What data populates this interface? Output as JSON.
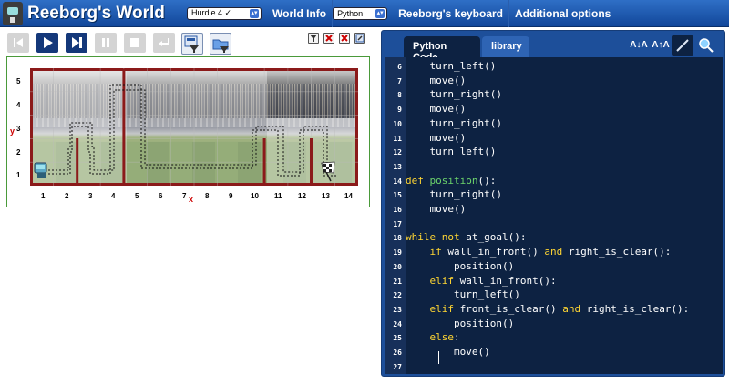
{
  "app": {
    "title": "Reeborg's World"
  },
  "topbar": {
    "world_select": "Hurdle 4 ✓",
    "world_info": "World Info",
    "language_select": "Python",
    "keyboard": "Reeborg's keyboard",
    "options": "Additional options"
  },
  "world": {
    "x_numbers": [
      "1",
      "2",
      "3",
      "4",
      "5",
      "6",
      "7",
      "8",
      "9",
      "10",
      "11",
      "12",
      "13",
      "14"
    ],
    "y_numbers": [
      "1",
      "2",
      "3",
      "4",
      "5"
    ],
    "x_label": "x",
    "y_label": "y"
  },
  "editor": {
    "tab_code": "Python Code",
    "tab_library": "library",
    "tool_decrease": "A↓A",
    "tool_increase": "A↑A",
    "lines": [
      {
        "n": "6",
        "t": "    turn_left()"
      },
      {
        "n": "7",
        "t": "    move()"
      },
      {
        "n": "8",
        "t": "    turn_right()"
      },
      {
        "n": "9",
        "t": "    move()"
      },
      {
        "n": "10",
        "t": "    turn_right()"
      },
      {
        "n": "11",
        "t": "    move()"
      },
      {
        "n": "12",
        "t": "    turn_left()"
      },
      {
        "n": "13",
        "t": ""
      },
      {
        "n": "14",
        "t": "def position():"
      },
      {
        "n": "15",
        "t": "    turn_right()"
      },
      {
        "n": "16",
        "t": "    move()"
      },
      {
        "n": "17",
        "t": ""
      },
      {
        "n": "18",
        "t": "while not at_goal():"
      },
      {
        "n": "19",
        "t": "    if wall_in_front() and right_is_clear():"
      },
      {
        "n": "20",
        "t": "        position()"
      },
      {
        "n": "21",
        "t": "    elif wall_in_front():"
      },
      {
        "n": "22",
        "t": "        turn_left()"
      },
      {
        "n": "23",
        "t": "    elif front_is_clear() and right_is_clear():"
      },
      {
        "n": "24",
        "t": "        position()"
      },
      {
        "n": "25",
        "t": "    else:"
      },
      {
        "n": "26",
        "t": "        move()"
      },
      {
        "n": "27",
        "t": ""
      }
    ]
  },
  "colors": {
    "accent": "#14387a",
    "wall": "#8b1a1a",
    "keyword": "#ffd633",
    "function": "#6bd36b"
  }
}
